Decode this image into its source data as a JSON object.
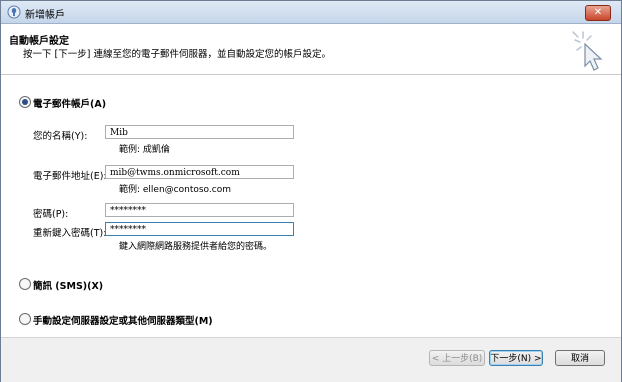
{
  "window": {
    "title": "新增帳戶",
    "close_glyph": "✕"
  },
  "header": {
    "title": "自動帳戶設定",
    "description": "按一下 [下一步] 連線至您的電子郵件伺服器，並自動設定您的帳戶設定。"
  },
  "options": {
    "email_account": {
      "label": "電子郵件帳戶(A)",
      "selected": true
    },
    "sms": {
      "label": "簡訊 (SMS)(X)",
      "selected": false
    },
    "manual": {
      "label": "手動設定伺服器設定或其他伺服器類型(M)",
      "selected": false
    }
  },
  "form": {
    "name": {
      "label": "您的名稱(Y):",
      "value": "Mib",
      "example": "範例: 成凱倫"
    },
    "email": {
      "label": "電子郵件地址(E):",
      "value": "mib@twms.onmicrosoft.com",
      "example": "範例: ellen@contoso.com"
    },
    "password": {
      "label": "密碼(P):",
      "value": "********"
    },
    "confirm_password": {
      "label": "重新鍵入密碼(T):",
      "value": "********",
      "hint": "鍵入網際網路服務提供者給您的密碼。"
    }
  },
  "buttons": {
    "back": "< 上一步(B)",
    "next": "下一步(N) >",
    "cancel": "取消"
  },
  "colors": {
    "accent": "#3c7fb1",
    "radio_dot": "#2b4f86"
  }
}
